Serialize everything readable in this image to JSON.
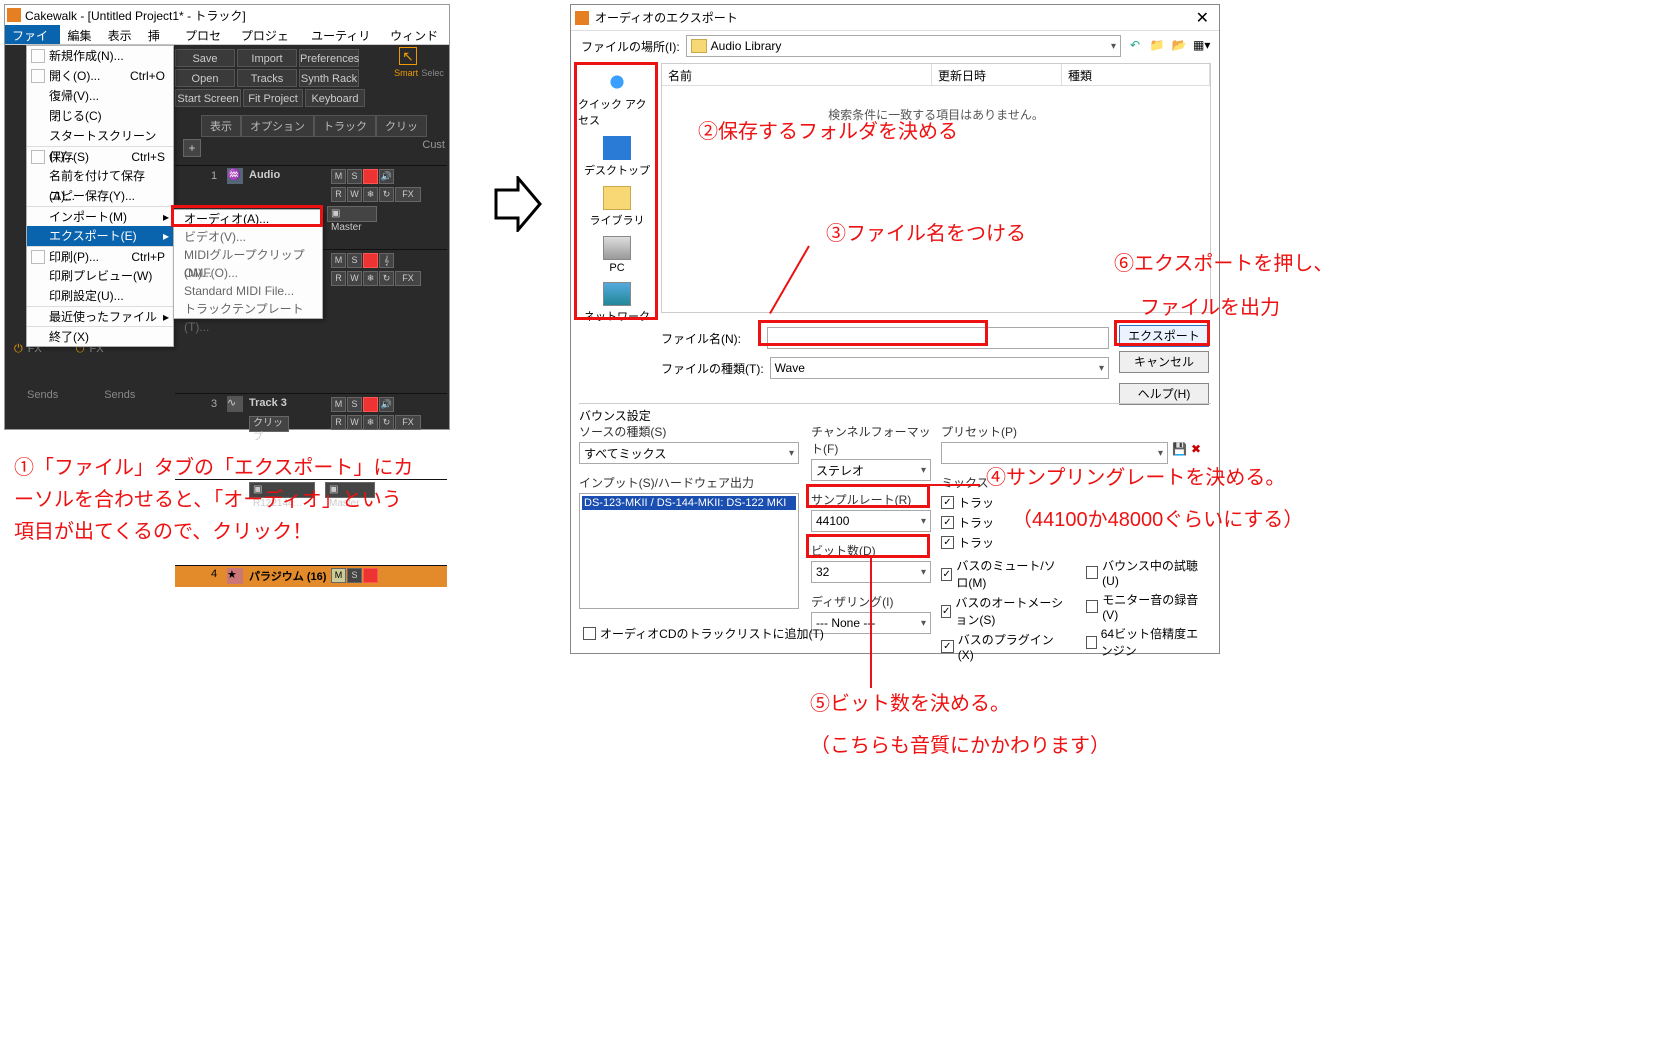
{
  "cakewalk": {
    "title": "Cakewalk - [Untitled Project1* - トラック]",
    "menubar": [
      "ファイル(F)",
      "編集(E)",
      "表示(V)",
      "挿入(I)",
      "プロセス(P)",
      "プロジェクト(J)",
      "ユーティリティ(U)",
      "ウィンドウ(W)"
    ],
    "toolbar1": [
      "Save",
      "Import",
      "Preferences"
    ],
    "toolbar2": [
      "Open",
      "Tracks",
      "Synth Rack"
    ],
    "toolbar3": [
      "Start Screen",
      "Fit Project",
      "Keyboard"
    ],
    "smart_label": "Smart",
    "select_label": "Selec",
    "custom_label": "Cust",
    "sel_row": [
      "表示",
      "オプション",
      "トラック",
      "クリッ"
    ],
    "file_menu": [
      {
        "label": "新規作成(N)...",
        "icon": true
      },
      {
        "label": "開く(O)...",
        "sc": "Ctrl+O",
        "icon": true
      },
      {
        "label": "復帰(V)..."
      },
      {
        "label": "閉じる(C)"
      },
      {
        "label": "スタートスクリーン(T)..."
      },
      {
        "label": "保存(S)",
        "sep": true,
        "sc": "Ctrl+S",
        "icon": true
      },
      {
        "label": "名前を付けて保存(A)..."
      },
      {
        "label": "コピー保存(Y)..."
      },
      {
        "label": "インポート(M)",
        "sep": true,
        "arr": true
      },
      {
        "label": "エクスポート(E)",
        "arr": true,
        "hover": true
      },
      {
        "label": "印刷(P)...",
        "sep": true,
        "sc": "Ctrl+P",
        "icon": true
      },
      {
        "label": "印刷プレビュー(W)"
      },
      {
        "label": "印刷設定(U)..."
      },
      {
        "label": "最近使ったファイル",
        "sep": true,
        "arr": true
      },
      {
        "label": "終了(X)",
        "sep": true
      }
    ],
    "export_submenu": [
      {
        "label": "オーディオ(A)..."
      },
      {
        "label": "ビデオ(V)..."
      },
      {
        "label": "MIDIグループクリップ(M)..."
      },
      {
        "label": "OMF(O)..."
      },
      {
        "label": "Standard MIDI File..."
      },
      {
        "label": "トラックテンプレート(T)..."
      }
    ],
    "fx_label": "FX",
    "sends_label": "Sends",
    "tracks": [
      {
        "num": "1",
        "name": "Audio",
        "clip": "",
        "master": "Master"
      },
      {
        "num": "",
        "name": "",
        "clip": "",
        "master": ""
      },
      {
        "num": "3",
        "name": "Track 3",
        "clip": "クリップ",
        "input": "R122144...",
        "master": "Master"
      },
      {
        "num": "4",
        "name": "パラジウム (16)",
        "clip": "",
        "master": ""
      }
    ],
    "track_btn_m": "M",
    "track_btn_s": "S",
    "track_btn_r": "R",
    "track_btn_w": "W",
    "track_fx": "FX"
  },
  "export": {
    "title": "オーディオのエクスポート",
    "loc_label": "ファイルの場所(I):",
    "loc_value": "Audio Library",
    "places": [
      "クイック アクセス",
      "デスクトップ",
      "ライブラリ",
      "PC",
      "ネットワーク"
    ],
    "cols": {
      "name": "名前",
      "date": "更新日時",
      "type": "種類"
    },
    "empty_msg": "検索条件に一致する項目はありません。",
    "filename_label": "ファイル名(N):",
    "filename_value": "",
    "filetype_label": "ファイルの種類(T):",
    "filetype_value": "Wave",
    "btn_export": "エクスポート",
    "btn_cancel": "キャンセル",
    "btn_help": "ヘルプ(H)",
    "bounce_header": "バウンス設定",
    "source_label": "ソースの種類(S)",
    "source_value": "すべてミックス",
    "input_label": "インプット(S)/ハードウェア出力",
    "input_item": "DS-123-MKII / DS-144-MKII: DS-122 MKI",
    "chan_label": "チャンネルフォーマット(F)",
    "chan_value": "ステレオ",
    "rate_label": "サンプルレート(R)",
    "rate_value": "44100",
    "bits_label": "ビット数(D)",
    "bits_value": "32",
    "dither_label": "ディザリング(I)",
    "dither_value": "--- None ---",
    "preset_label": "プリセット(P)",
    "mix_label": "ミックス",
    "checks": [
      {
        "label": "トラッ",
        "checked": true
      },
      {
        "label": "トラッ",
        "checked": true
      },
      {
        "label": "トラッ",
        "checked": true
      },
      {
        "label": "バスのミュート/ソロ(M)",
        "checked": true
      },
      {
        "label": "バスのオートメーション(S)",
        "checked": true
      },
      {
        "label": "バスのプラグイン(X)",
        "checked": true
      }
    ],
    "checks_right": [
      {
        "label": "バウンス中の試聴(U)",
        "checked": false
      },
      {
        "label": "モニター音の録音(V)",
        "checked": false
      },
      {
        "label": "64ビット倍精度エンジン",
        "checked": false
      }
    ],
    "add_cd": "オーディオCDのトラックリストに追加(T)"
  },
  "annotations": {
    "a1": "①「ファイル」タブの「エクスポート」にカーソルを合わせると、「オーディオ」という項目が出てくるので、クリック！",
    "a2": "②保存するフォルダを決める",
    "a3": "③ファイル名をつける",
    "a4a": "④サンプリングレートを決める。",
    "a4b": "（44100か48000ぐらいにする）",
    "a5a": "⑤ビット数を決める。",
    "a5b": "（こちらも音質にかかわります）",
    "a6a": "⑥エクスポートを押し、",
    "a6b": "ファイルを出力"
  }
}
